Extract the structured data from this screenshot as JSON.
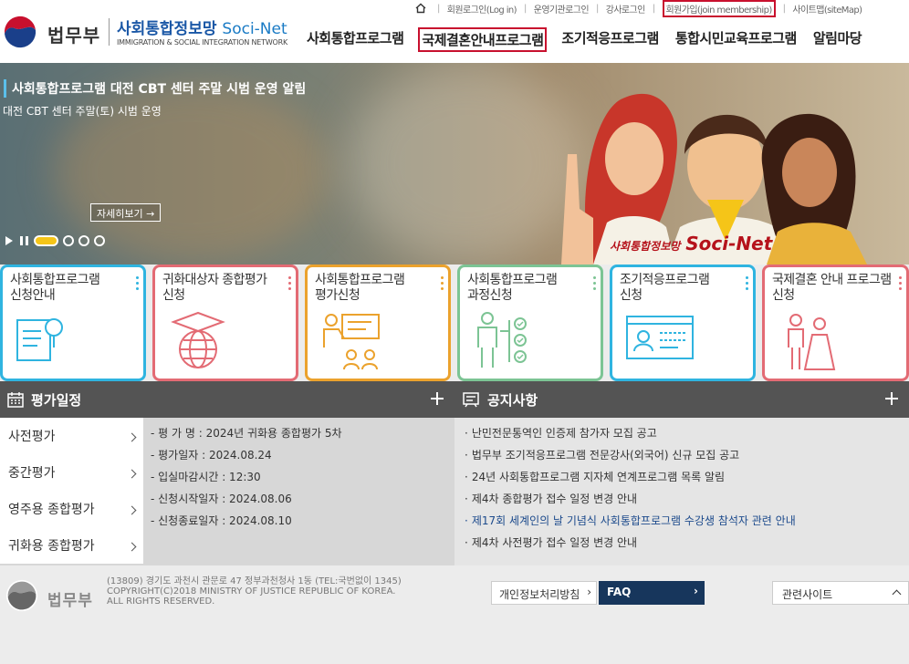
{
  "header": {
    "org": "법무부",
    "site_title": "사회통합정보망",
    "site_title_en": "Soci-Net",
    "site_subtitle": "IMMIGRATION & SOCIAL INTEGRATION NETWORK",
    "util_links": [
      "회원로그인(Log in)",
      "운영기관로그인",
      "강사로그인",
      "회원가입(join membership)",
      "사이트맵(siteMap)"
    ],
    "nav": [
      "사회통합프로그램",
      "국제결혼안내프로그램",
      "조기적응프로그램",
      "통합시민교육프로그램",
      "알림마당"
    ]
  },
  "hero": {
    "title": "사회통합프로그램 대전 CBT 센터 주말 시범 운영 알림",
    "desc": "대전 CBT 센터 주말(토) 시범 운영",
    "more": "자세히보기 →",
    "signature_ko": "사회통합정보망",
    "signature_en": "Soci-Net"
  },
  "cards": [
    {
      "label1": "사회통합프로그램",
      "label2": "신청안내",
      "color": "#2fb4e0"
    },
    {
      "label1": "귀화대상자 종합평가",
      "label2": "신청",
      "color": "#e36b74"
    },
    {
      "label1": "사회통합프로그램",
      "label2": "평가신청",
      "color": "#eba22d"
    },
    {
      "label1": "사회통합프로그램",
      "label2": "과정신청",
      "color": "#7cc494"
    },
    {
      "label1": "조기적응프로그램",
      "label2": "신청",
      "color": "#2fb4e0"
    },
    {
      "label1": "국제결혼 안내 프로그램",
      "label2": "신청",
      "color": "#e36b74"
    }
  ],
  "schedule": {
    "heading": "평가일정",
    "tabs": [
      "사전평가",
      "중간평가",
      "영주용 종합평가",
      "귀화용 종합평가"
    ],
    "items": [
      "- 평 가 명 : 2024년 귀화용 종합평가 5차",
      "- 평가일자 : 2024.08.24",
      "- 입실마감시간 : 12:30",
      "- 신청시작일자 : 2024.08.06",
      "- 신청종료일자 : 2024.08.10"
    ]
  },
  "notice": {
    "heading": "공지사항",
    "items": [
      "난민전문통역인 인증제 참가자 모집 공고",
      "법무부 조기적응프로그램 전문강사(외국어) 신규 모집 공고",
      "24년 사회통합프로그램 지자체 연계프로그램 목록 알림",
      "제4차 종합평가 접수 일정 변경 안내",
      "제17회 세계인의 날 기념식 사회통합프로그램 수강생 참석자 관련 안내",
      "제4차 사전평가 접수 일정 변경 안내"
    ]
  },
  "footer": {
    "org": "법무부",
    "address": "(13809) 경기도 과천시 관문로 47 정부과천청사 1동 (TEL:국번없이 1345)",
    "copyright": "COPYRIGHT(C)2018 MINISTRY OF JUSTICE REPUBLIC OF KOREA.",
    "rights": "ALL RIGHTS RESERVED.",
    "privacy": "개인정보처리방침",
    "faq": "FAQ",
    "related": "관련사이트"
  }
}
